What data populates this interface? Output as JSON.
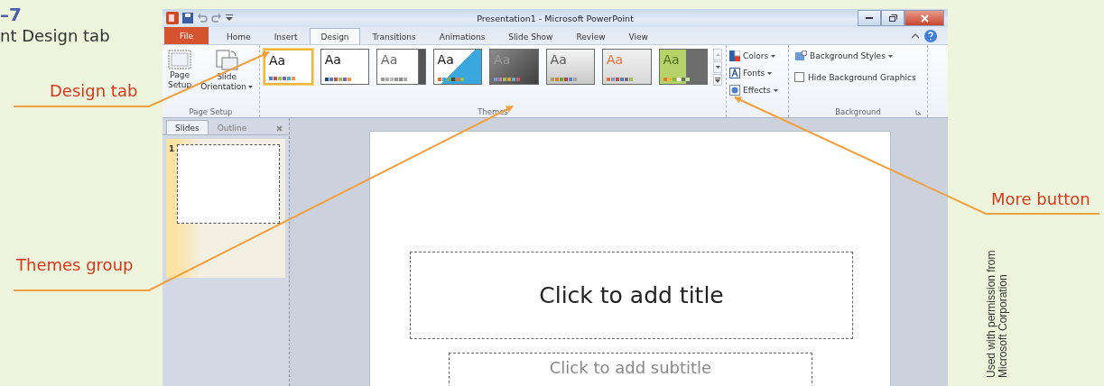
{
  "caption": {
    "number": "–7",
    "text": "nt Design tab"
  },
  "window": {
    "title": "Presentation1 - Microsoft PowerPoint"
  },
  "tabs": [
    {
      "label": "File",
      "kind": "file",
      "selected": false
    },
    {
      "label": "Home",
      "kind": "tab",
      "selected": false
    },
    {
      "label": "Insert",
      "kind": "tab",
      "selected": false
    },
    {
      "label": "Design",
      "kind": "tab",
      "selected": true
    },
    {
      "label": "Transitions",
      "kind": "tab",
      "selected": false
    },
    {
      "label": "Animations",
      "kind": "tab",
      "selected": false
    },
    {
      "label": "Slide Show",
      "kind": "tab",
      "selected": false
    },
    {
      "label": "Review",
      "kind": "tab",
      "selected": false
    },
    {
      "label": "View",
      "kind": "tab",
      "selected": false
    }
  ],
  "page_setup_group": {
    "label": "Page Setup",
    "buttons": [
      {
        "lines": [
          "Page",
          "Setup"
        ],
        "kind": "page",
        "dropdown": false
      },
      {
        "lines": [
          "Slide",
          "Orientation"
        ],
        "kind": "orientation",
        "dropdown": true
      }
    ]
  },
  "themes_group": {
    "label": "Themes",
    "themes": [
      {
        "sample": "Aa",
        "kind": "office",
        "selected": true
      },
      {
        "sample": "Aa",
        "kind": "plain",
        "selected": false
      },
      {
        "sample": "Aa",
        "kind": "grey",
        "selected": false
      },
      {
        "sample": "Aa",
        "kind": "diagonal",
        "selected": false
      },
      {
        "sample": "Aa",
        "kind": "dark",
        "selected": false
      },
      {
        "sample": "Aa",
        "kind": "boxed",
        "selected": false
      },
      {
        "sample": "Aa",
        "kind": "orange",
        "selected": false
      },
      {
        "sample": "Aa",
        "kind": "green",
        "selected": false
      }
    ]
  },
  "theme_options": [
    {
      "label": "Colors",
      "kind": "colors"
    },
    {
      "label": "Fonts",
      "kind": "fonts"
    },
    {
      "label": "Effects",
      "kind": "effects"
    }
  ],
  "background_group": {
    "label": "Background",
    "styles_button": "Background Styles",
    "hide_graphics": {
      "label": "Hide Background Graphics",
      "checked": false
    }
  },
  "slides_pane": {
    "tabs": [
      {
        "label": "Slides",
        "selected": true
      },
      {
        "label": "Outline",
        "selected": false
      }
    ],
    "thumbnails": [
      {
        "number": "1",
        "selected": true
      }
    ]
  },
  "slide": {
    "title_placeholder": "Click to add title",
    "subtitle_placeholder": "Click to add subtitle"
  },
  "callouts": [
    {
      "label": "Design tab"
    },
    {
      "label": "Themes group"
    },
    {
      "label": "More button"
    }
  ],
  "credit": "Used with permission from Microsoft Corporation"
}
